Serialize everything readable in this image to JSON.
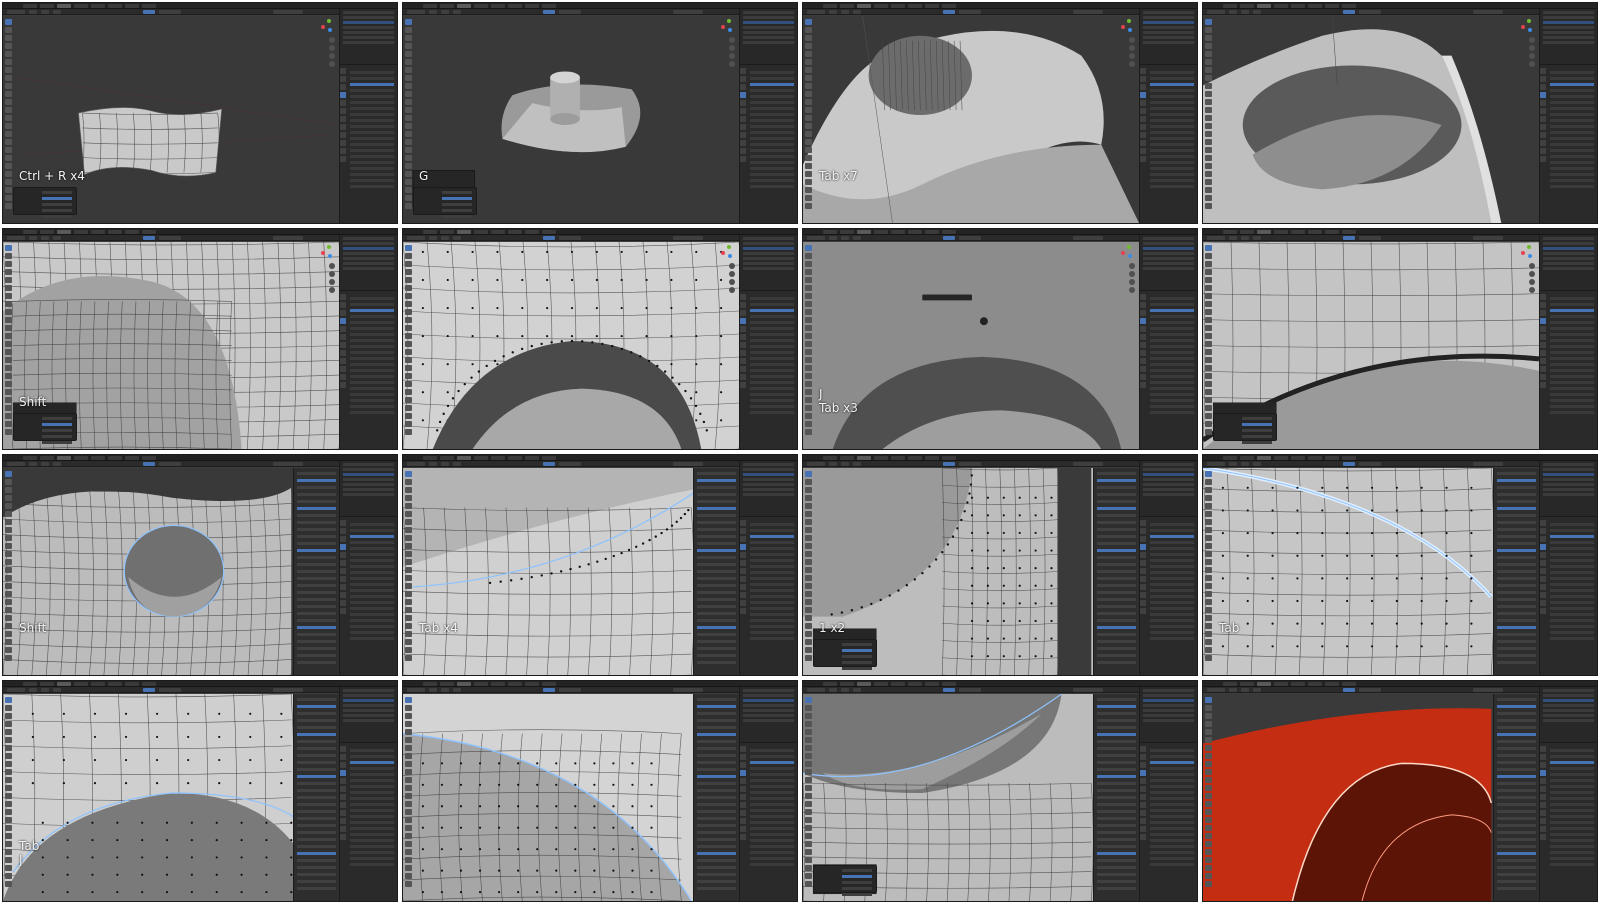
{
  "frames": [
    {
      "id": 1,
      "hint": "Ctrl + R x4",
      "scene": "mesh-strip",
      "npanel": false,
      "opbox": true
    },
    {
      "id": 2,
      "hint": "G",
      "scene": "cylinder-plane",
      "npanel": false,
      "opbox": true
    },
    {
      "id": 3,
      "hint": "Tab x7",
      "scene": "hole-top",
      "npanel": false,
      "opbox": false
    },
    {
      "id": 4,
      "hint": "",
      "scene": "hole-side",
      "npanel": false,
      "opbox": false
    },
    {
      "id": 5,
      "hint": "Shift",
      "scene": "grid-hole",
      "npanel": false,
      "opbox": true
    },
    {
      "id": 6,
      "hint": "",
      "scene": "grid-closeup",
      "npanel": false,
      "opbox": false
    },
    {
      "id": 7,
      "hint": "J\nTab x3",
      "scene": "dark-arc",
      "npanel": false,
      "opbox": false
    },
    {
      "id": 8,
      "hint": "",
      "scene": "edge-loop",
      "npanel": false,
      "opbox": true
    },
    {
      "id": 9,
      "hint": "Shift",
      "scene": "grid-hole-blue",
      "npanel": true,
      "opbox": false
    },
    {
      "id": 10,
      "hint": "Tab x4",
      "scene": "ring-edge",
      "npanel": true,
      "opbox": false
    },
    {
      "id": 11,
      "hint": "1 x2",
      "scene": "vertical-split",
      "npanel": true,
      "opbox": true
    },
    {
      "id": 12,
      "hint": "Tab",
      "scene": "bevel-edge",
      "npanel": true,
      "opbox": false
    },
    {
      "id": 13,
      "hint": "Tab\nJ",
      "scene": "arc-verts",
      "npanel": true,
      "opbox": false
    },
    {
      "id": 14,
      "hint": "",
      "scene": "bevel-closeup",
      "npanel": true,
      "opbox": false
    },
    {
      "id": 15,
      "hint": "",
      "scene": "saddle-hole",
      "npanel": true,
      "opbox": true
    },
    {
      "id": 16,
      "hint": "",
      "scene": "render-red",
      "npanel": true,
      "opbox": false
    }
  ],
  "colors": {
    "viewport_bg": "#393939",
    "surface_light": "#c9c9c9",
    "surface_mid": "#9a9a9a",
    "surface_dark": "#5c5c5c",
    "wire": "#3a3a3a",
    "vertex": "#111111",
    "select_edge": "#8ec3ff",
    "render_red": "#c42d12",
    "ui_blue": "#4772b3"
  }
}
